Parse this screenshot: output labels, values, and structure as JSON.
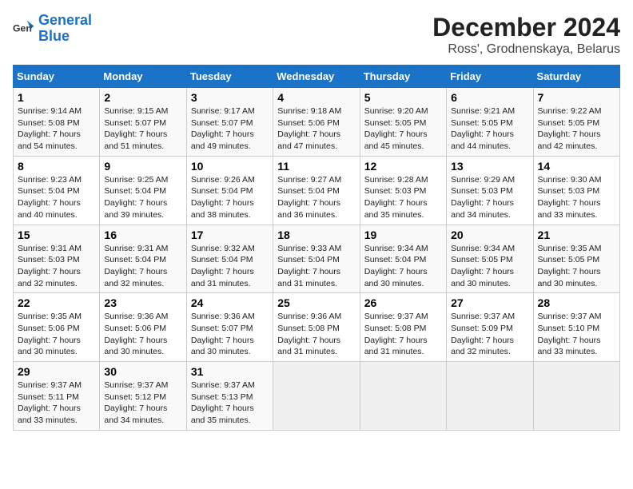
{
  "header": {
    "logo_line1": "General",
    "logo_line2": "Blue",
    "title": "December 2024",
    "subtitle": "Ross', Grodnenskaya, Belarus"
  },
  "days_of_week": [
    "Sunday",
    "Monday",
    "Tuesday",
    "Wednesday",
    "Thursday",
    "Friday",
    "Saturday"
  ],
  "weeks": [
    [
      {
        "day": "1",
        "sunrise": "9:14 AM",
        "sunset": "5:08 PM",
        "daylight": "7 hours and 54 minutes."
      },
      {
        "day": "2",
        "sunrise": "9:15 AM",
        "sunset": "5:07 PM",
        "daylight": "7 hours and 51 minutes."
      },
      {
        "day": "3",
        "sunrise": "9:17 AM",
        "sunset": "5:07 PM",
        "daylight": "7 hours and 49 minutes."
      },
      {
        "day": "4",
        "sunrise": "9:18 AM",
        "sunset": "5:06 PM",
        "daylight": "7 hours and 47 minutes."
      },
      {
        "day": "5",
        "sunrise": "9:20 AM",
        "sunset": "5:05 PM",
        "daylight": "7 hours and 45 minutes."
      },
      {
        "day": "6",
        "sunrise": "9:21 AM",
        "sunset": "5:05 PM",
        "daylight": "7 hours and 44 minutes."
      },
      {
        "day": "7",
        "sunrise": "9:22 AM",
        "sunset": "5:05 PM",
        "daylight": "7 hours and 42 minutes."
      }
    ],
    [
      {
        "day": "8",
        "sunrise": "9:23 AM",
        "sunset": "5:04 PM",
        "daylight": "7 hours and 40 minutes."
      },
      {
        "day": "9",
        "sunrise": "9:25 AM",
        "sunset": "5:04 PM",
        "daylight": "7 hours and 39 minutes."
      },
      {
        "day": "10",
        "sunrise": "9:26 AM",
        "sunset": "5:04 PM",
        "daylight": "7 hours and 38 minutes."
      },
      {
        "day": "11",
        "sunrise": "9:27 AM",
        "sunset": "5:04 PM",
        "daylight": "7 hours and 36 minutes."
      },
      {
        "day": "12",
        "sunrise": "9:28 AM",
        "sunset": "5:03 PM",
        "daylight": "7 hours and 35 minutes."
      },
      {
        "day": "13",
        "sunrise": "9:29 AM",
        "sunset": "5:03 PM",
        "daylight": "7 hours and 34 minutes."
      },
      {
        "day": "14",
        "sunrise": "9:30 AM",
        "sunset": "5:03 PM",
        "daylight": "7 hours and 33 minutes."
      }
    ],
    [
      {
        "day": "15",
        "sunrise": "9:31 AM",
        "sunset": "5:03 PM",
        "daylight": "7 hours and 32 minutes."
      },
      {
        "day": "16",
        "sunrise": "9:31 AM",
        "sunset": "5:04 PM",
        "daylight": "7 hours and 32 minutes."
      },
      {
        "day": "17",
        "sunrise": "9:32 AM",
        "sunset": "5:04 PM",
        "daylight": "7 hours and 31 minutes."
      },
      {
        "day": "18",
        "sunrise": "9:33 AM",
        "sunset": "5:04 PM",
        "daylight": "7 hours and 31 minutes."
      },
      {
        "day": "19",
        "sunrise": "9:34 AM",
        "sunset": "5:04 PM",
        "daylight": "7 hours and 30 minutes."
      },
      {
        "day": "20",
        "sunrise": "9:34 AM",
        "sunset": "5:05 PM",
        "daylight": "7 hours and 30 minutes."
      },
      {
        "day": "21",
        "sunrise": "9:35 AM",
        "sunset": "5:05 PM",
        "daylight": "7 hours and 30 minutes."
      }
    ],
    [
      {
        "day": "22",
        "sunrise": "9:35 AM",
        "sunset": "5:06 PM",
        "daylight": "7 hours and 30 minutes."
      },
      {
        "day": "23",
        "sunrise": "9:36 AM",
        "sunset": "5:06 PM",
        "daylight": "7 hours and 30 minutes."
      },
      {
        "day": "24",
        "sunrise": "9:36 AM",
        "sunset": "5:07 PM",
        "daylight": "7 hours and 30 minutes."
      },
      {
        "day": "25",
        "sunrise": "9:36 AM",
        "sunset": "5:08 PM",
        "daylight": "7 hours and 31 minutes."
      },
      {
        "day": "26",
        "sunrise": "9:37 AM",
        "sunset": "5:08 PM",
        "daylight": "7 hours and 31 minutes."
      },
      {
        "day": "27",
        "sunrise": "9:37 AM",
        "sunset": "5:09 PM",
        "daylight": "7 hours and 32 minutes."
      },
      {
        "day": "28",
        "sunrise": "9:37 AM",
        "sunset": "5:10 PM",
        "daylight": "7 hours and 33 minutes."
      }
    ],
    [
      {
        "day": "29",
        "sunrise": "9:37 AM",
        "sunset": "5:11 PM",
        "daylight": "7 hours and 33 minutes."
      },
      {
        "day": "30",
        "sunrise": "9:37 AM",
        "sunset": "5:12 PM",
        "daylight": "7 hours and 34 minutes."
      },
      {
        "day": "31",
        "sunrise": "9:37 AM",
        "sunset": "5:13 PM",
        "daylight": "7 hours and 35 minutes."
      },
      null,
      null,
      null,
      null
    ]
  ]
}
